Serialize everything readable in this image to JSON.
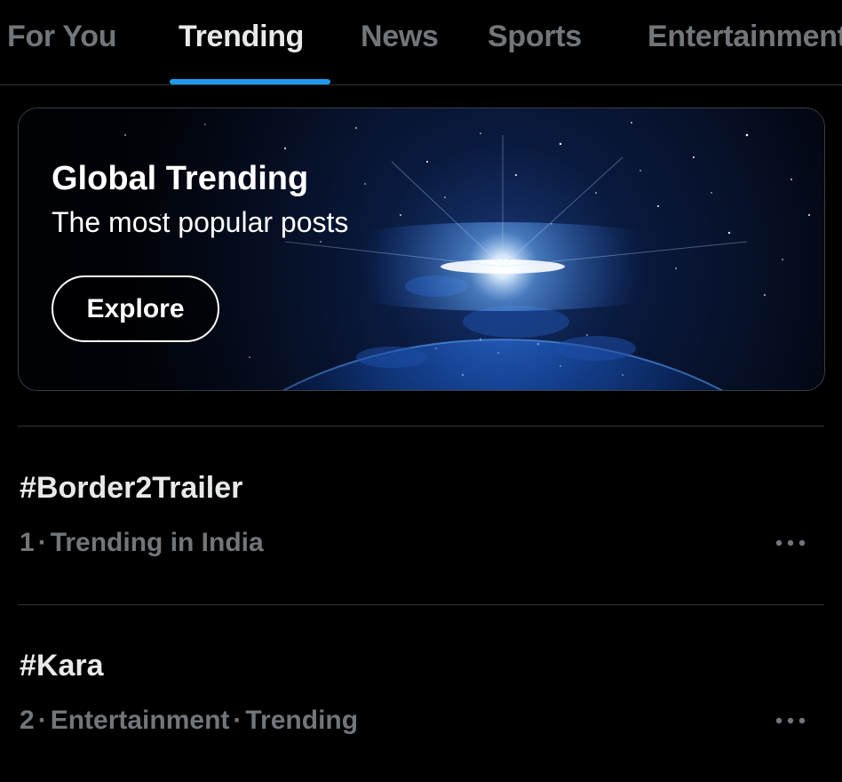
{
  "tabs": [
    {
      "label": "For You",
      "active": false
    },
    {
      "label": "Trending",
      "active": true
    },
    {
      "label": "News",
      "active": false
    },
    {
      "label": "Sports",
      "active": false
    },
    {
      "label": "Entertainment",
      "active": false
    }
  ],
  "banner": {
    "title": "Global Trending",
    "subtitle": "The most popular posts",
    "button_label": "Explore",
    "image_icon": "earth-from-space-image"
  },
  "trends": [
    {
      "name": "#Border2Trailer",
      "rank": "1",
      "context": [
        "Trending in India"
      ],
      "more_icon": "more-horizontal-icon"
    },
    {
      "name": "#Kara",
      "rank": "2",
      "context": [
        "Entertainment",
        "Trending"
      ],
      "more_icon": "more-horizontal-icon"
    }
  ],
  "colors": {
    "background": "#000000",
    "accent": "#1d9bf0",
    "text_primary": "#e7e9ea",
    "text_secondary": "#71767b",
    "divider": "#2f3336"
  }
}
